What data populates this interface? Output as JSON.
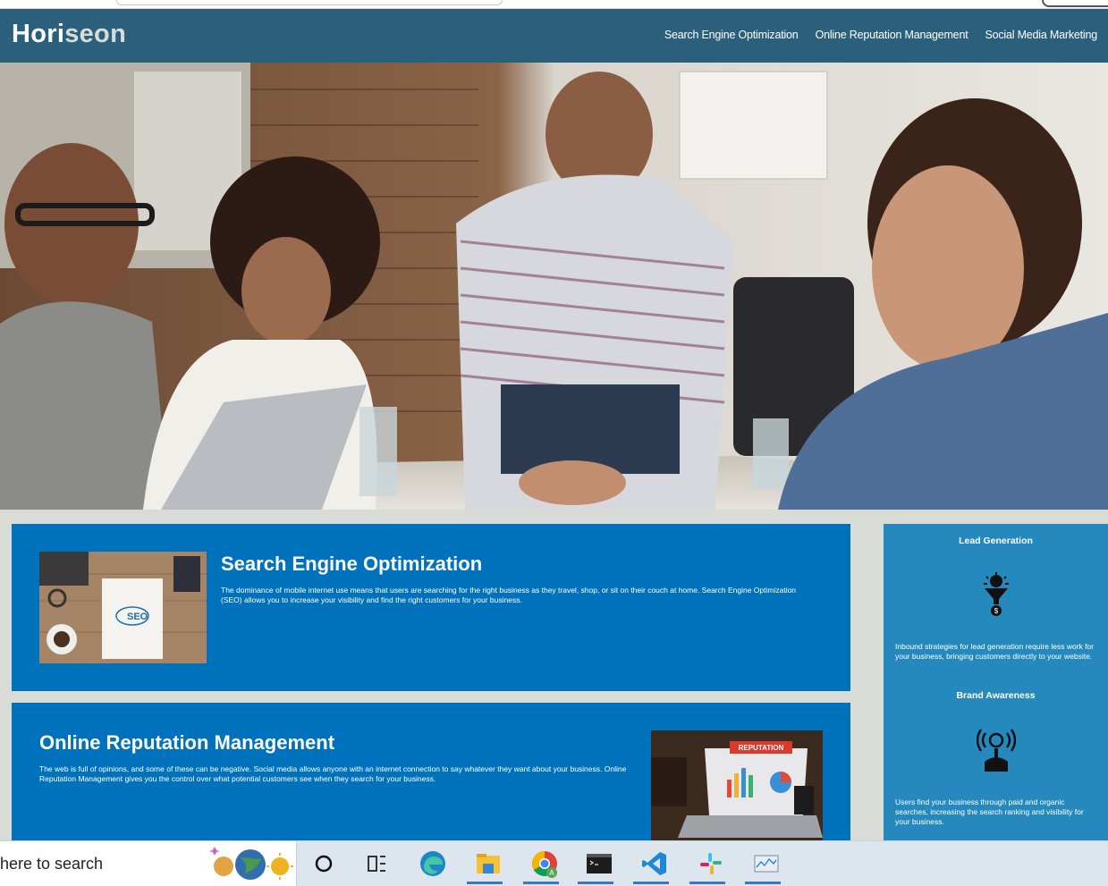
{
  "header": {
    "logo_main": "Hori",
    "logo_accent": "seon",
    "nav": [
      "Search Engine Optimization",
      "Online Reputation Management",
      "Social Media Marketing"
    ]
  },
  "hero": {
    "alt": "Team meeting around a table with laptops"
  },
  "content": {
    "seo": {
      "title": "Search Engine Optimization",
      "text": "The dominance of mobile internet use means that users are searching for the right business as they travel, shop, or sit on their couch at home. Search Engine Optimization (SEO) allows you to increase your visibility and find the right customers for your business."
    },
    "orm": {
      "title": "Online Reputation Management",
      "text": "The web is full of opinions, and some of these can be negative. Social media allows anyone with an internet connection to say whatever they want about your business. Online Reputation Management gives you the control over what potential customers see when they search for your business."
    }
  },
  "benefits": {
    "lead": {
      "title": "Lead Generation",
      "text": "Inbound strategies for lead generation require less work for your business, bringing customers directly to your website."
    },
    "brand": {
      "title": "Brand Awareness",
      "text": "Users find your business through paid and organic searches, increasing the search ranking and visibility for your business."
    }
  },
  "taskbar": {
    "search_text": "here to search",
    "icons": [
      "weather-icon",
      "cortana-icon",
      "task-view-icon",
      "edge-icon",
      "file-explorer-icon",
      "chrome-icon",
      "terminal-icon",
      "vscode-icon",
      "slack-icon",
      "resource-monitor-icon"
    ]
  },
  "colors": {
    "header_bg": "#2a607c",
    "content_bg": "#0072bb",
    "aside_bg": "#2589bd",
    "page_bg": "#d9dcd6"
  }
}
